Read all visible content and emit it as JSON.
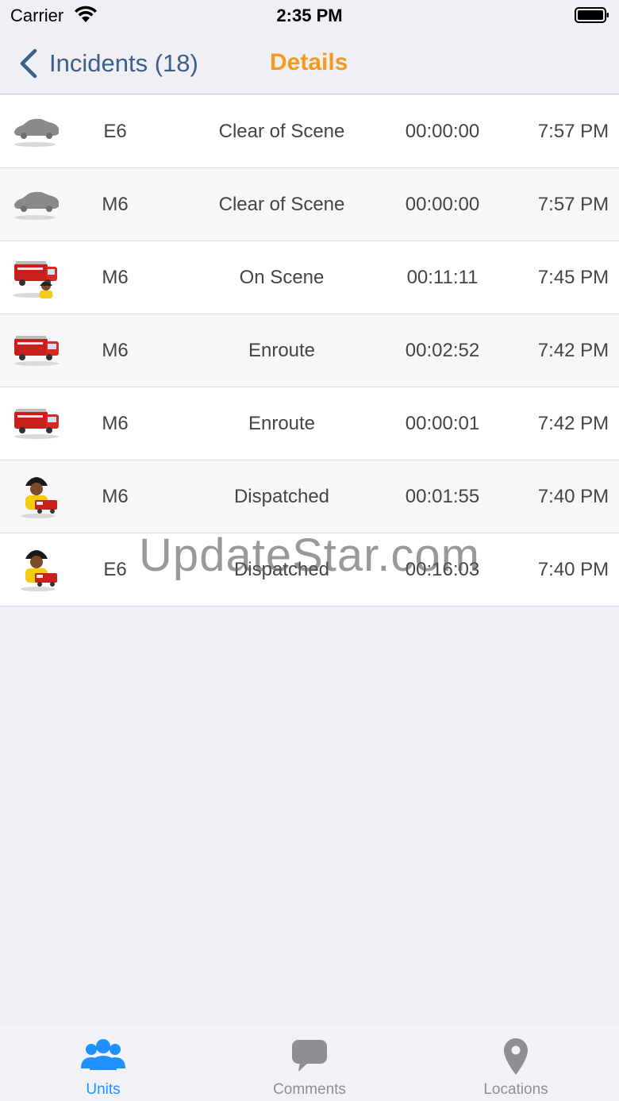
{
  "status_bar": {
    "carrier": "Carrier",
    "time": "2:35 PM"
  },
  "nav": {
    "back_label": "Incidents (18)",
    "title": "Details"
  },
  "rows": [
    {
      "icon": "car-icon",
      "unit": "E6",
      "status": "Clear of Scene",
      "elapsed": "00:00:00",
      "time": "7:57 PM"
    },
    {
      "icon": "car-icon",
      "unit": "M6",
      "status": "Clear of Scene",
      "elapsed": "00:00:00",
      "time": "7:57 PM"
    },
    {
      "icon": "fire-truck-firefighter-icon",
      "unit": "M6",
      "status": "On Scene",
      "elapsed": "00:11:11",
      "time": "7:45 PM"
    },
    {
      "icon": "fire-truck-icon",
      "unit": "M6",
      "status": "Enroute",
      "elapsed": "00:02:52",
      "time": "7:42 PM"
    },
    {
      "icon": "fire-truck-icon",
      "unit": "M6",
      "status": "Enroute",
      "elapsed": "00:00:01",
      "time": "7:42 PM"
    },
    {
      "icon": "firefighter-icon",
      "unit": "M6",
      "status": "Dispatched",
      "elapsed": "00:01:55",
      "time": "7:40 PM"
    },
    {
      "icon": "firefighter-icon",
      "unit": "E6",
      "status": "Dispatched",
      "elapsed": "00:16:03",
      "time": "7:40 PM"
    }
  ],
  "watermark": "UpdateStar.com",
  "tabs": [
    {
      "label": "Units",
      "icon": "users-icon",
      "active": true
    },
    {
      "label": "Comments",
      "icon": "comment-bubble-icon",
      "active": false
    },
    {
      "label": "Locations",
      "icon": "map-pin-icon",
      "active": false
    }
  ],
  "colors": {
    "accent_orange": "#f39a1f",
    "back_blue": "#3c5f8c",
    "tab_active": "#1e90ff",
    "tab_inactive": "#8e8e93",
    "background": "#efeff4"
  }
}
